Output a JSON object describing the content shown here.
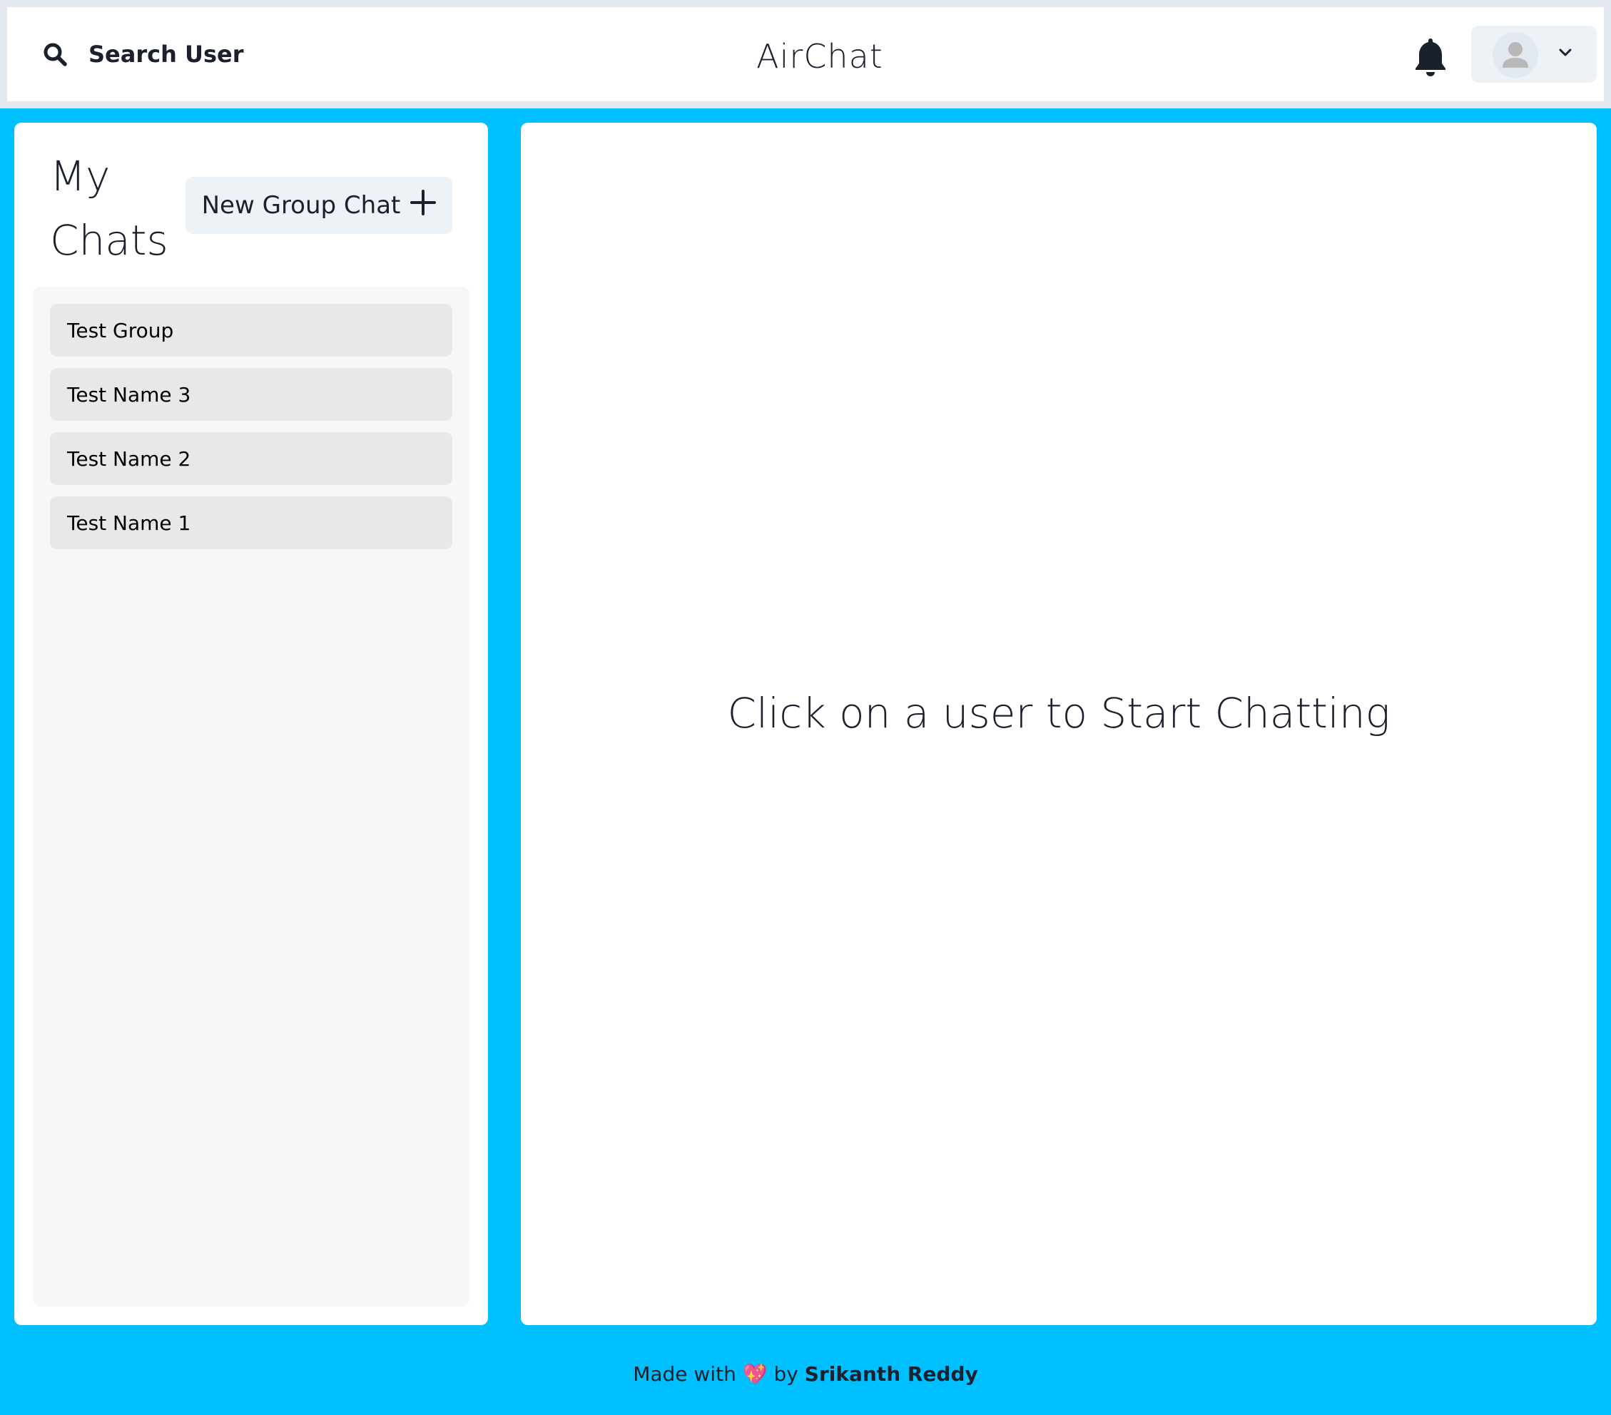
{
  "header": {
    "search_label": "Search User",
    "app_title": "AirChat",
    "icons": {
      "search": "search-icon",
      "notifications": "bell-icon",
      "avatar": "user-avatar-icon",
      "menu": "chevron-down-icon"
    }
  },
  "sidebar": {
    "title": "My Chats",
    "new_group_label": "New Group Chat",
    "chats": [
      {
        "name": "Test Group"
      },
      {
        "name": "Test Name 3"
      },
      {
        "name": "Test Name 2"
      },
      {
        "name": "Test Name 1"
      }
    ]
  },
  "main": {
    "placeholder": "Click on a user to Start Chatting"
  },
  "footer": {
    "prefix": "Made with",
    "heart": "💖",
    "by": "by",
    "author": "Srikanth Reddy"
  },
  "colors": {
    "background": "#00bfff",
    "panel": "#ffffff",
    "chat_item": "#e8e8e8"
  }
}
